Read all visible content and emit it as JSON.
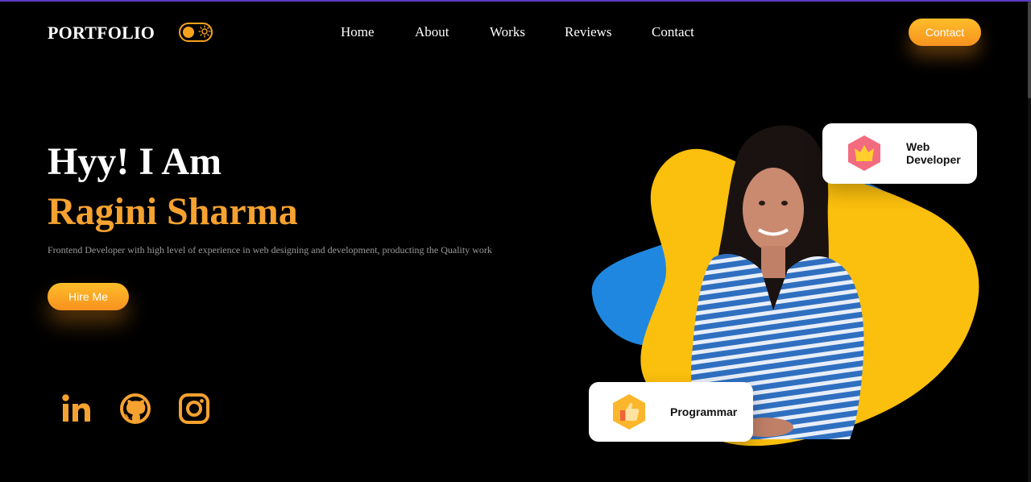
{
  "header": {
    "logo": "PORTFOLIO",
    "nav": [
      "Home",
      "About",
      "Works",
      "Reviews",
      "Contact"
    ],
    "contact_button": "Contact"
  },
  "hero": {
    "greeting": "Hyy! I Am",
    "name": "Ragini Sharma",
    "description": "Frontend Developer with high level of experience in web designing and development, producting the Quality work",
    "hire_button": "Hire Me"
  },
  "cards": {
    "web_line1": "Web",
    "web_line2": "Developer",
    "programmer": "Programmar"
  },
  "social": [
    "linkedin-icon",
    "github-icon",
    "instagram-icon"
  ],
  "colors": {
    "accent": "#f6a230",
    "blob_yellow": "#fbbf0d",
    "blob_blue": "#1f87e0",
    "nav_line": "#5b3cc4"
  }
}
